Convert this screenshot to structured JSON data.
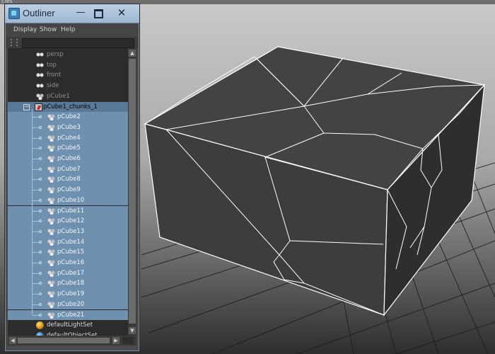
{
  "window": {
    "title": "Outliner",
    "minimize_symbol": "—",
    "close_symbol": "✕",
    "menu": [
      "Display",
      "Show",
      "Help"
    ],
    "filter_value": ""
  },
  "top_fragment": "cles",
  "outliner_items": [
    {
      "label": "persp",
      "kind": "camera"
    },
    {
      "label": "top",
      "kind": "camera"
    },
    {
      "label": "front",
      "kind": "camera"
    },
    {
      "label": "side",
      "kind": "camera"
    },
    {
      "label": "pCube1",
      "kind": "camera-mesh"
    },
    {
      "label": "pCube1_chunks_1",
      "kind": "group"
    },
    {
      "label": "pCube2",
      "kind": "mesh"
    },
    {
      "label": "pCube3",
      "kind": "mesh"
    },
    {
      "label": "pCube4",
      "kind": "mesh"
    },
    {
      "label": "pCube5",
      "kind": "mesh"
    },
    {
      "label": "pCube6",
      "kind": "mesh"
    },
    {
      "label": "pCube7",
      "kind": "mesh"
    },
    {
      "label": "pCube8",
      "kind": "mesh"
    },
    {
      "label": "pCube9",
      "kind": "mesh"
    },
    {
      "label": "pCube10",
      "kind": "mesh"
    },
    {
      "label": "pCube11",
      "kind": "mesh"
    },
    {
      "label": "pCube12",
      "kind": "mesh"
    },
    {
      "label": "pCube13",
      "kind": "mesh"
    },
    {
      "label": "pCube14",
      "kind": "mesh"
    },
    {
      "label": "pCube15",
      "kind": "mesh"
    },
    {
      "label": "pCube16",
      "kind": "mesh"
    },
    {
      "label": "pCube17",
      "kind": "mesh"
    },
    {
      "label": "pCube18",
      "kind": "mesh"
    },
    {
      "label": "pCube19",
      "kind": "mesh"
    },
    {
      "label": "pCube20",
      "kind": "mesh"
    },
    {
      "label": "pCube21",
      "kind": "mesh"
    },
    {
      "label": "defaultLightSet",
      "kind": "light-set"
    },
    {
      "label": "defaultObjectSet",
      "kind": "object-set"
    }
  ],
  "icons": {
    "camera": "camera-icon",
    "mesh": "mesh-icon",
    "group": "group-icon",
    "light_set": "light-set-icon",
    "scroll_up": "▲",
    "scroll_down": "▼",
    "scroll_left": "◀",
    "scroll_right": "▶"
  },
  "colors": {
    "viewport_grey": "#b8b8b8",
    "grid_dark": "#2f2f2f",
    "cube_face": "#424242",
    "cube_side": "#2d2d2d",
    "selection_blue": "#6f90ae",
    "titlebar_blue": "#bcd0e6"
  }
}
